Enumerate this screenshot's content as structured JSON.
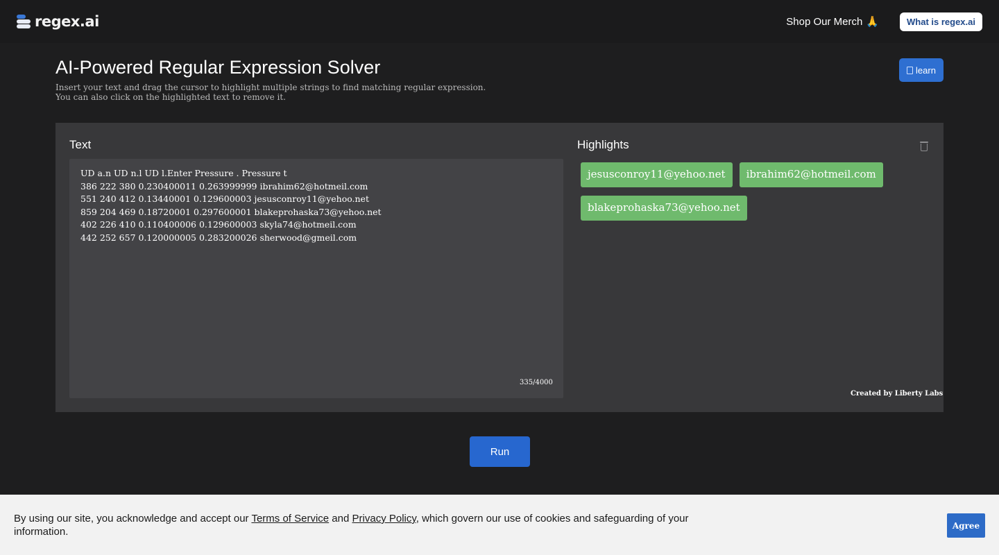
{
  "header": {
    "logo_text": "regex.ai",
    "merch_label": "Shop Our Merch",
    "merch_emoji": "🙏",
    "what_is_label": "What is regex.ai"
  },
  "page": {
    "title": "AI-Powered Regular Expression Solver",
    "subtitle_line1": "Insert your text and drag the cursor to highlight multiple strings to find matching regular expression.",
    "subtitle_line2": "You can also click on the highlighted text to remove it.",
    "learn_label": "learn"
  },
  "text_panel": {
    "label": "Text",
    "content": "UD a.n UD n.l UD l.Enter Pressure . Pressure t\n386 222 380 0.230400011 0.263999999 ibrahim62@hotmeil.com\n551 240 412 0.13440001 0.129600003 jesusconroy11@yehoo.net\n859 204 469 0.18720001 0.297600001 blakeprohaska73@yehoo.net\n402 226 410 0.110400006 0.129600003 skyla74@hotmeil.com\n442 252 657 0.120000005 0.283200026 sherwood@gmeil.com",
    "counter": "335/4000"
  },
  "highlights_panel": {
    "label": "Highlights",
    "items": [
      "jesusconroy11@yehoo.net",
      "ibrahim62@hotmeil.com",
      "blakeprohaska73@yehoo.net"
    ],
    "credit": "Created by Liberty Labs"
  },
  "run_label": "Run",
  "cookie": {
    "text_before": "By using our site, you acknowledge and accept our ",
    "terms_link": "Terms of Service",
    "and": " and ",
    "privacy_link": "Privacy Policy",
    "text_after": ", which govern our use of cookies and safeguarding of your information.",
    "agree_label": "Agree"
  },
  "colors": {
    "accent": "#2e6fd1",
    "highlight_chip": "#6fba6d",
    "background": "#1e1e1f",
    "panel": "#38383a"
  }
}
